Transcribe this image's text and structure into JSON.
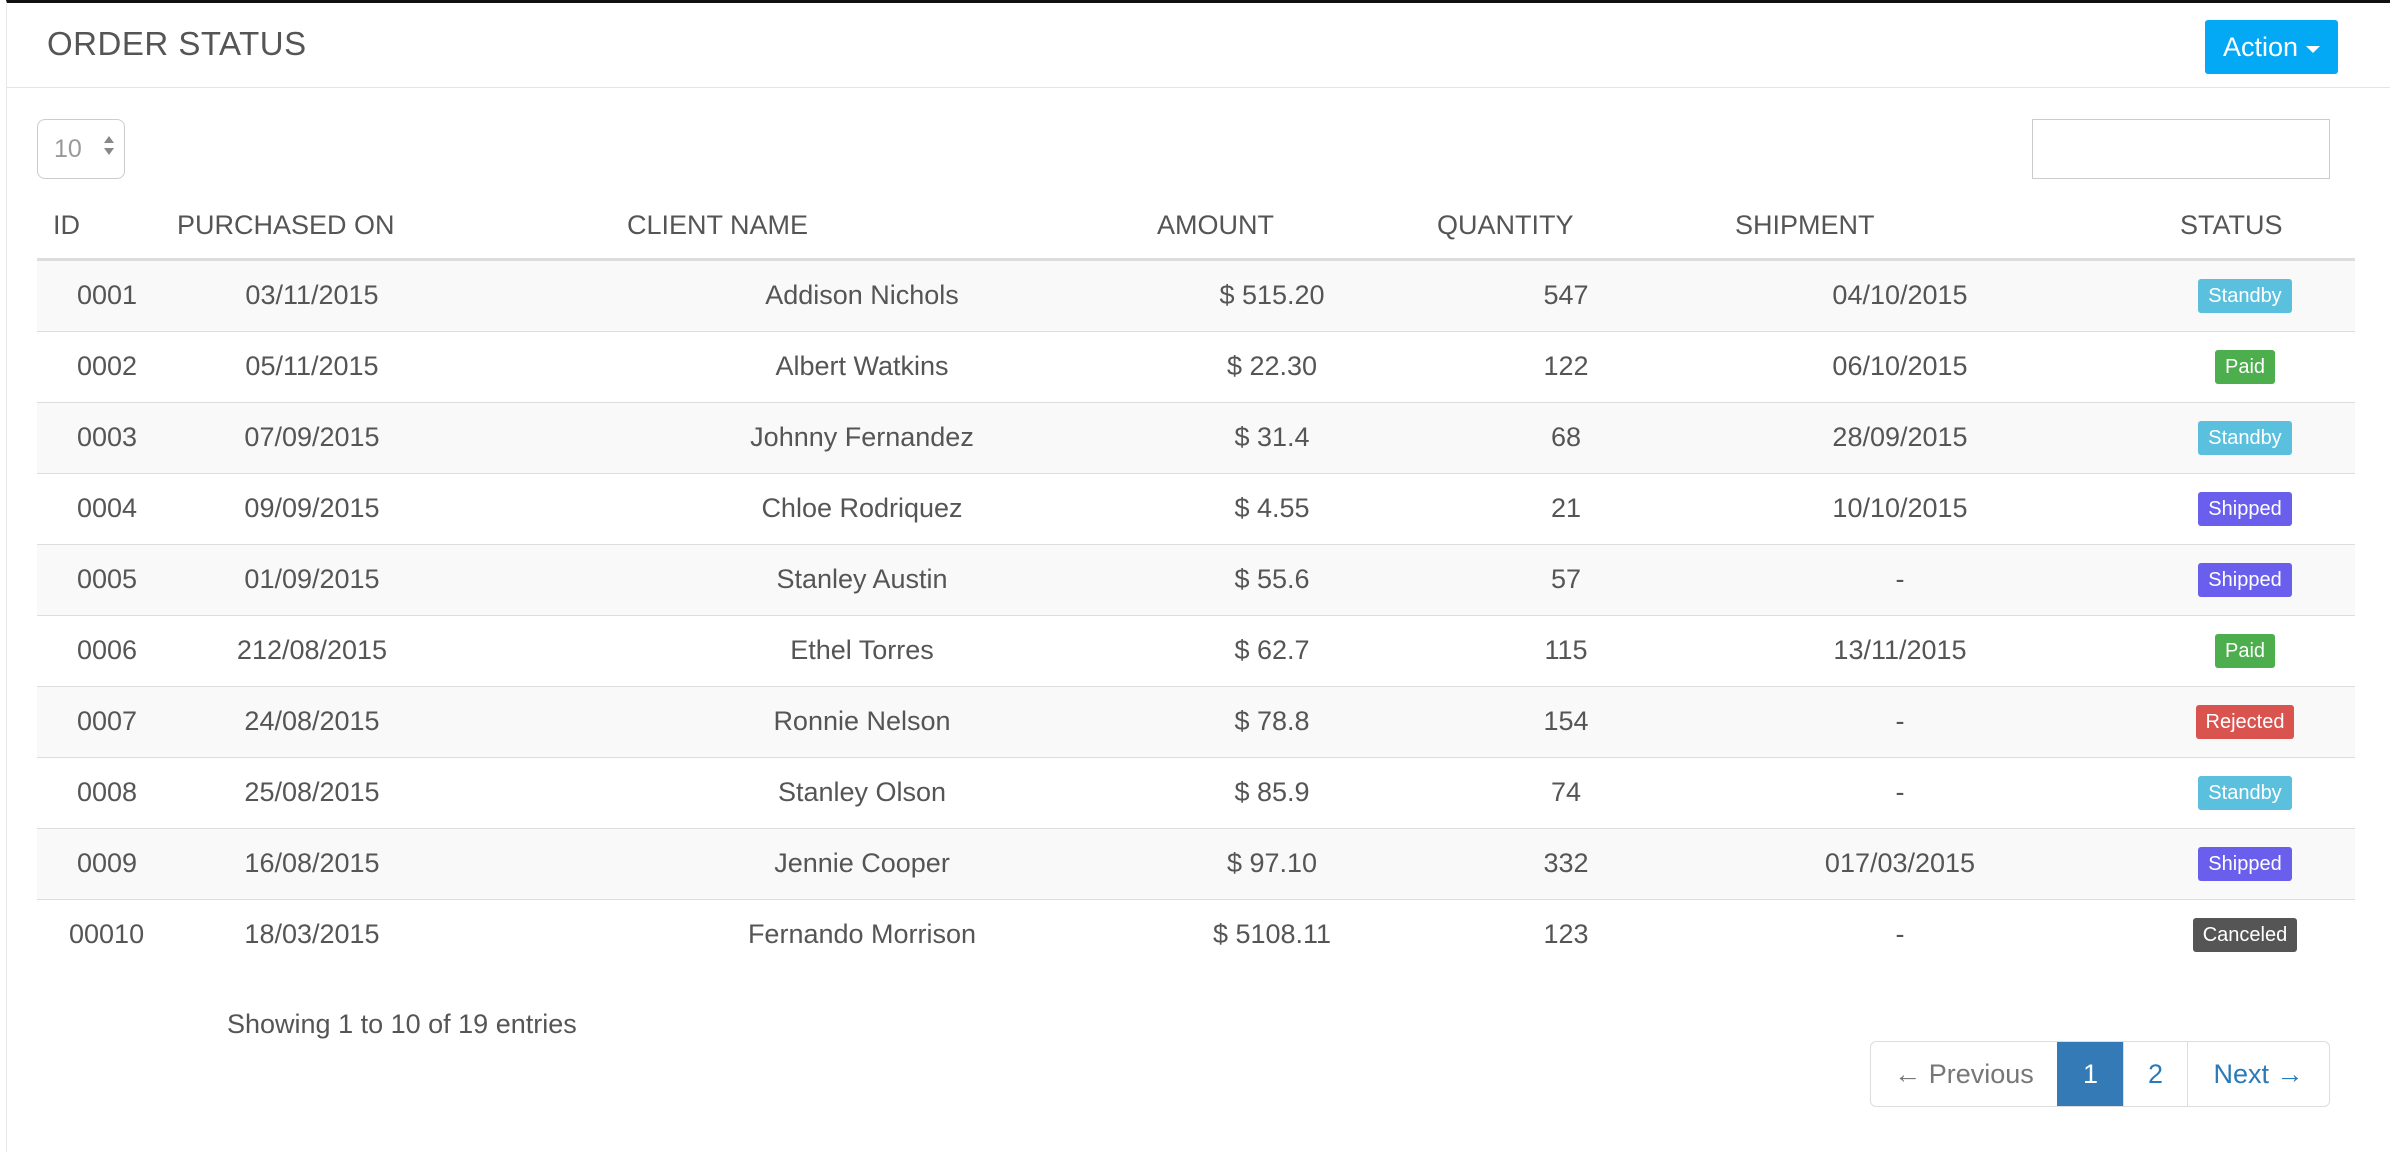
{
  "panel": {
    "title": "ORDER STATUS",
    "action_label": "Action"
  },
  "controls": {
    "page_length": "10",
    "search_value": ""
  },
  "columns": [
    "ID",
    "PURCHASED ON",
    "CLIENT NAME",
    "AMOUNT",
    "QUANTITY",
    "SHIPMENT",
    "STATUS"
  ],
  "rows": [
    {
      "id": "0001",
      "purchased": "03/11/2015",
      "client": "Addison Nichols",
      "amount": "$ 515.20",
      "quantity": "547",
      "shipment": "04/10/2015",
      "status": "Standby",
      "status_color": "#5bc0de"
    },
    {
      "id": "0002",
      "purchased": "05/11/2015",
      "client": "Albert Watkins",
      "amount": "$ 22.30",
      "quantity": "122",
      "shipment": "06/10/2015",
      "status": "Paid",
      "status_color": "#4cae4c"
    },
    {
      "id": "0003",
      "purchased": "07/09/2015",
      "client": "Johnny Fernandez",
      "amount": "$ 31.4",
      "quantity": "68",
      "shipment": "28/09/2015",
      "status": "Standby",
      "status_color": "#5bc0de"
    },
    {
      "id": "0004",
      "purchased": "09/09/2015",
      "client": "Chloe Rodriquez",
      "amount": "$ 4.55",
      "quantity": "21",
      "shipment": "10/10/2015",
      "status": "Shipped",
      "status_color": "#6a5eec"
    },
    {
      "id": "0005",
      "purchased": "01/09/2015",
      "client": "Stanley Austin",
      "amount": "$ 55.6",
      "quantity": "57",
      "shipment": "-",
      "status": "Shipped",
      "status_color": "#6a5eec"
    },
    {
      "id": "0006",
      "purchased": "212/08/2015",
      "client": "Ethel Torres",
      "amount": "$ 62.7",
      "quantity": "115",
      "shipment": "13/11/2015",
      "status": "Paid",
      "status_color": "#4cae4c"
    },
    {
      "id": "0007",
      "purchased": "24/08/2015",
      "client": "Ronnie Nelson",
      "amount": "$ 78.8",
      "quantity": "154",
      "shipment": "-",
      "status": "Rejected",
      "status_color": "#d9534f"
    },
    {
      "id": "0008",
      "purchased": "25/08/2015",
      "client": "Stanley Olson",
      "amount": "$ 85.9",
      "quantity": "74",
      "shipment": "-",
      "status": "Standby",
      "status_color": "#5bc0de"
    },
    {
      "id": "0009",
      "purchased": "16/08/2015",
      "client": "Jennie Cooper",
      "amount": "$ 97.10",
      "quantity": "332",
      "shipment": "017/03/2015",
      "status": "Shipped",
      "status_color": "#6a5eec"
    },
    {
      "id": "00010",
      "purchased": "18/03/2015",
      "client": "Fernando Morrison",
      "amount": "$ 5108.11",
      "quantity": "123",
      "shipment": "-",
      "status": "Canceled",
      "status_color": "#555555"
    }
  ],
  "footer": {
    "info": "Showing 1 to 10 of 19 entries"
  },
  "pagination": {
    "previous": "← Previous",
    "pages": [
      "1",
      "2"
    ],
    "active_page": "1",
    "next": "Next →"
  },
  "colors": {
    "action_button": "#03a9f4",
    "active_page": "#337ab7",
    "link": "#2a7ab9"
  }
}
